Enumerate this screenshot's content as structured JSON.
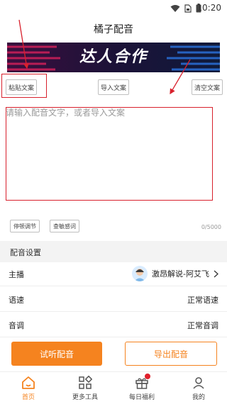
{
  "status_bar": {
    "time": "10:20"
  },
  "header": {
    "title": "橘子配音"
  },
  "banner": {
    "text": "达人合作"
  },
  "toolbar": {
    "paste_label": "粘贴文案",
    "import_label": "导入文案",
    "clear_label": "清空文案"
  },
  "editor": {
    "placeholder": "请输入配音文字，或者导入文案",
    "pause_label": "停顿调节",
    "sensitive_label": "查敏感词",
    "counter": "0/5000"
  },
  "settings": {
    "section_title": "配音设置",
    "rows": [
      {
        "label": "主播",
        "value": "激昂解说-阿艾飞"
      },
      {
        "label": "语速",
        "value": "正常语速"
      },
      {
        "label": "音调",
        "value": "正常音调"
      }
    ]
  },
  "actions": {
    "preview_label": "试听配音",
    "export_label": "导出配音"
  },
  "bottom_nav": {
    "items": [
      {
        "label": "首页",
        "icon": "home-icon"
      },
      {
        "label": "更多工具",
        "icon": "tools-icon"
      },
      {
        "label": "每日福利",
        "icon": "gift-icon"
      },
      {
        "label": "我的",
        "icon": "profile-icon"
      }
    ]
  },
  "colors": {
    "accent": "#f5831f",
    "annotation_red": "#d8202c",
    "badge_red": "#e0202c"
  }
}
